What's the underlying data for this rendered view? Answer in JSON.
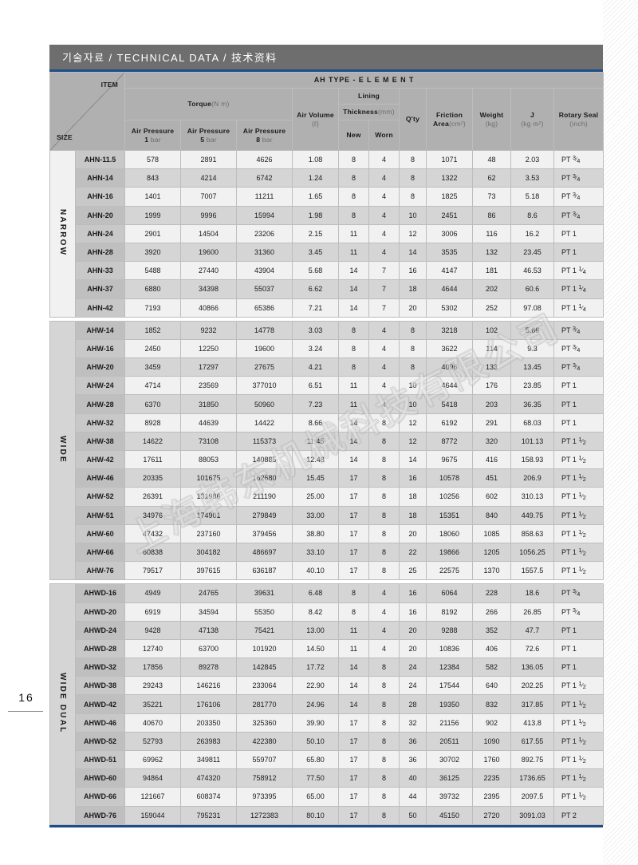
{
  "page": {
    "number": "16"
  },
  "title_bar": {
    "text": "기술자료 / TECHNICAL DATA / 技术资料"
  },
  "watermark": {
    "text": "上海韩东机械科技有限公司"
  },
  "header": {
    "corner": {
      "item": "ITEM",
      "size": "SIZE"
    },
    "main_group": "AH TYPE - E L E M E N T",
    "torque": {
      "label": "Torque",
      "unit": "(N m)"
    },
    "air_pressure_1": {
      "label": "Air Pressure",
      "value": "1",
      "unit": "bar"
    },
    "air_pressure_5": {
      "label": "Air Pressure",
      "value": "5",
      "unit": "bar"
    },
    "air_pressure_8": {
      "label": "Air Pressure",
      "value": "8",
      "unit": "bar"
    },
    "air_volume": {
      "label": "Air Volume",
      "unit": "(ℓ)"
    },
    "lining": "Lining",
    "thickness": {
      "label": "Thickness",
      "unit": "(mm)"
    },
    "new": "New",
    "worn": "Worn",
    "qty": "Q'ty",
    "friction_area": {
      "label": "Friction Area",
      "unit": "(cm²)"
    },
    "weight": {
      "label": "Weight",
      "unit": "(kg)"
    },
    "j": {
      "label": "J",
      "unit": "(kg m²)"
    },
    "rotary_seal": {
      "label": "Rotary Seal",
      "unit": "(inch)"
    }
  },
  "groups": [
    {
      "name": "NARROW",
      "rows": [
        {
          "size": "AHN-11.5",
          "t1": "578",
          "t5": "2891",
          "t8": "4626",
          "air": "1.08",
          "new": "8",
          "worn": "4",
          "qty": "8",
          "fa": "1071",
          "wt": "48",
          "j": "2.03",
          "seal": "PT 3/4"
        },
        {
          "size": "AHN-14",
          "t1": "843",
          "t5": "4214",
          "t8": "6742",
          "air": "1.24",
          "new": "8",
          "worn": "4",
          "qty": "8",
          "fa": "1322",
          "wt": "62",
          "j": "3.53",
          "seal": "PT 3/4"
        },
        {
          "size": "AHN-16",
          "t1": "1401",
          "t5": "7007",
          "t8": "11211",
          "air": "1.65",
          "new": "8",
          "worn": "4",
          "qty": "8",
          "fa": "1825",
          "wt": "73",
          "j": "5.18",
          "seal": "PT 3/4"
        },
        {
          "size": "AHN-20",
          "t1": "1999",
          "t5": "9996",
          "t8": "15994",
          "air": "1.98",
          "new": "8",
          "worn": "4",
          "qty": "10",
          "fa": "2451",
          "wt": "86",
          "j": "8.6",
          "seal": "PT 3/4"
        },
        {
          "size": "AHN-24",
          "t1": "2901",
          "t5": "14504",
          "t8": "23206",
          "air": "2.15",
          "new": "11",
          "worn": "4",
          "qty": "12",
          "fa": "3006",
          "wt": "116",
          "j": "16.2",
          "seal": "PT 1"
        },
        {
          "size": "AHN-28",
          "t1": "3920",
          "t5": "19600",
          "t8": "31360",
          "air": "3.45",
          "new": "11",
          "worn": "4",
          "qty": "14",
          "fa": "3535",
          "wt": "132",
          "j": "23.45",
          "seal": "PT 1"
        },
        {
          "size": "AHN-33",
          "t1": "5488",
          "t5": "27440",
          "t8": "43904",
          "air": "5.68",
          "new": "14",
          "worn": "7",
          "qty": "16",
          "fa": "4147",
          "wt": "181",
          "j": "46.53",
          "seal": "PT 1 1/4"
        },
        {
          "size": "AHN-37",
          "t1": "6880",
          "t5": "34398",
          "t8": "55037",
          "air": "6.62",
          "new": "14",
          "worn": "7",
          "qty": "18",
          "fa": "4644",
          "wt": "202",
          "j": "60.6",
          "seal": "PT 1 1/4"
        },
        {
          "size": "AHN-42",
          "t1": "7193",
          "t5": "40866",
          "t8": "65386",
          "air": "7.21",
          "new": "14",
          "worn": "7",
          "qty": "20",
          "fa": "5302",
          "wt": "252",
          "j": "97.08",
          "seal": "PT 1 1/4"
        }
      ]
    },
    {
      "name": "WIDE",
      "rows": [
        {
          "size": "AHW-14",
          "t1": "1852",
          "t5": "9232",
          "t8": "14778",
          "air": "3.03",
          "new": "8",
          "worn": "4",
          "qty": "8",
          "fa": "3218",
          "wt": "102",
          "j": "5.66",
          "seal": "PT 3/4"
        },
        {
          "size": "AHW-16",
          "t1": "2450",
          "t5": "12250",
          "t8": "19600",
          "air": "3.24",
          "new": "8",
          "worn": "4",
          "qty": "8",
          "fa": "3622",
          "wt": "114",
          "j": "9.3",
          "seal": "PT 3/4"
        },
        {
          "size": "AHW-20",
          "t1": "3459",
          "t5": "17297",
          "t8": "27675",
          "air": "4.21",
          "new": "8",
          "worn": "4",
          "qty": "8",
          "fa": "4096",
          "wt": "133",
          "j": "13.45",
          "seal": "PT 3/4"
        },
        {
          "size": "AHW-24",
          "t1": "4714",
          "t5": "23569",
          "t8": "377010",
          "air": "6.51",
          "new": "11",
          "worn": "4",
          "qty": "10",
          "fa": "4644",
          "wt": "176",
          "j": "23.85",
          "seal": "PT 1"
        },
        {
          "size": "AHW-28",
          "t1": "6370",
          "t5": "31850",
          "t8": "50960",
          "air": "7.23",
          "new": "11",
          "worn": "4",
          "qty": "10",
          "fa": "5418",
          "wt": "203",
          "j": "36.35",
          "seal": "PT 1"
        },
        {
          "size": "AHW-32",
          "t1": "8928",
          "t5": "44639",
          "t8": "14422",
          "air": "8.66",
          "new": "14",
          "worn": "8",
          "qty": "12",
          "fa": "6192",
          "wt": "291",
          "j": "68.03",
          "seal": "PT 1"
        },
        {
          "size": "AHW-38",
          "t1": "14622",
          "t5": "73108",
          "t8": "115373",
          "air": "11.45",
          "new": "14",
          "worn": "8",
          "qty": "12",
          "fa": "8772",
          "wt": "320",
          "j": "101.13",
          "seal": "PT 1 1/2"
        },
        {
          "size": "AHW-42",
          "t1": "17611",
          "t5": "88053",
          "t8": "140885",
          "air": "12.48",
          "new": "14",
          "worn": "8",
          "qty": "14",
          "fa": "9675",
          "wt": "416",
          "j": "158.93",
          "seal": "PT 1 1/2"
        },
        {
          "size": "AHW-46",
          "t1": "20335",
          "t5": "101675",
          "t8": "162680",
          "air": "15.45",
          "new": "17",
          "worn": "8",
          "qty": "16",
          "fa": "10578",
          "wt": "451",
          "j": "206.9",
          "seal": "PT 1 1/2"
        },
        {
          "size": "AHW-52",
          "t1": "26391",
          "t5": "131986",
          "t8": "211190",
          "air": "25.00",
          "new": "17",
          "worn": "8",
          "qty": "18",
          "fa": "10256",
          "wt": "602",
          "j": "310.13",
          "seal": "PT 1 1/2"
        },
        {
          "size": "AHW-51",
          "t1": "34976",
          "t5": "174901",
          "t8": "279849",
          "air": "33.00",
          "new": "17",
          "worn": "8",
          "qty": "18",
          "fa": "15351",
          "wt": "840",
          "j": "449.75",
          "seal": "PT 1 1/2"
        },
        {
          "size": "AHW-60",
          "t1": "47432",
          "t5": "237160",
          "t8": "379456",
          "air": "38.80",
          "new": "17",
          "worn": "8",
          "qty": "20",
          "fa": "18060",
          "wt": "1085",
          "j": "858.63",
          "seal": "PT 1 1/2"
        },
        {
          "size": "AHW-66",
          "t1": "60838",
          "t5": "304182",
          "t8": "486697",
          "air": "33.10",
          "new": "17",
          "worn": "8",
          "qty": "22",
          "fa": "19866",
          "wt": "1205",
          "j": "1056.25",
          "seal": "PT 1 1/2"
        },
        {
          "size": "AHW-76",
          "t1": "79517",
          "t5": "397615",
          "t8": "636187",
          "air": "40.10",
          "new": "17",
          "worn": "8",
          "qty": "25",
          "fa": "22575",
          "wt": "1370",
          "j": "1557.5",
          "seal": "PT 1 1/2"
        }
      ]
    },
    {
      "name": "WIDE DUAL",
      "rows": [
        {
          "size": "AHWD-16",
          "t1": "4949",
          "t5": "24765",
          "t8": "39631",
          "air": "6.48",
          "new": "8",
          "worn": "4",
          "qty": "16",
          "fa": "6064",
          "wt": "228",
          "j": "18.6",
          "seal": "PT 3/4"
        },
        {
          "size": "AHWD-20",
          "t1": "6919",
          "t5": "34594",
          "t8": "55350",
          "air": "8.42",
          "new": "8",
          "worn": "4",
          "qty": "16",
          "fa": "8192",
          "wt": "266",
          "j": "26.85",
          "seal": "PT 3/4"
        },
        {
          "size": "AHWD-24",
          "t1": "9428",
          "t5": "47138",
          "t8": "75421",
          "air": "13.00",
          "new": "11",
          "worn": "4",
          "qty": "20",
          "fa": "9288",
          "wt": "352",
          "j": "47.7",
          "seal": "PT 1"
        },
        {
          "size": "AHWD-28",
          "t1": "12740",
          "t5": "63700",
          "t8": "101920",
          "air": "14.50",
          "new": "11",
          "worn": "4",
          "qty": "20",
          "fa": "10836",
          "wt": "406",
          "j": "72.6",
          "seal": "PT 1"
        },
        {
          "size": "AHWD-32",
          "t1": "17856",
          "t5": "89278",
          "t8": "142845",
          "air": "17.72",
          "new": "14",
          "worn": "8",
          "qty": "24",
          "fa": "12384",
          "wt": "582",
          "j": "136.05",
          "seal": "PT 1"
        },
        {
          "size": "AHWD-38",
          "t1": "29243",
          "t5": "146216",
          "t8": "233064",
          "air": "22.90",
          "new": "14",
          "worn": "8",
          "qty": "24",
          "fa": "17544",
          "wt": "640",
          "j": "202.25",
          "seal": "PT 1 1/2"
        },
        {
          "size": "AHWD-42",
          "t1": "35221",
          "t5": "176106",
          "t8": "281770",
          "air": "24.96",
          "new": "14",
          "worn": "8",
          "qty": "28",
          "fa": "19350",
          "wt": "832",
          "j": "317.85",
          "seal": "PT 1 1/2"
        },
        {
          "size": "AHWD-46",
          "t1": "40670",
          "t5": "203350",
          "t8": "325360",
          "air": "39.90",
          "new": "17",
          "worn": "8",
          "qty": "32",
          "fa": "21156",
          "wt": "902",
          "j": "413.8",
          "seal": "PT 1 1/2"
        },
        {
          "size": "AHWD-52",
          "t1": "52793",
          "t5": "263983",
          "t8": "422380",
          "air": "50.10",
          "new": "17",
          "worn": "8",
          "qty": "36",
          "fa": "20511",
          "wt": "1090",
          "j": "617.55",
          "seal": "PT 1 1/2"
        },
        {
          "size": "AHWD-51",
          "t1": "69962",
          "t5": "349811",
          "t8": "559707",
          "air": "65.80",
          "new": "17",
          "worn": "8",
          "qty": "36",
          "fa": "30702",
          "wt": "1760",
          "j": "892.75",
          "seal": "PT 1 1/2"
        },
        {
          "size": "AHWD-60",
          "t1": "94864",
          "t5": "474320",
          "t8": "758912",
          "air": "77.50",
          "new": "17",
          "worn": "8",
          "qty": "40",
          "fa": "36125",
          "wt": "2235",
          "j": "1736.65",
          "seal": "PT 1 1/2"
        },
        {
          "size": "AHWD-66",
          "t1": "121667",
          "t5": "608374",
          "t8": "973395",
          "air": "65.00",
          "new": "17",
          "worn": "8",
          "qty": "44",
          "fa": "39732",
          "wt": "2395",
          "j": "2097.5",
          "seal": "PT 1 1/2"
        },
        {
          "size": "AHWD-76",
          "t1": "159044",
          "t5": "795231",
          "t8": "1272383",
          "air": "80.10",
          "new": "17",
          "worn": "8",
          "qty": "50",
          "fa": "45150",
          "wt": "2720",
          "j": "3091.03",
          "seal": "PT 2"
        }
      ]
    }
  ]
}
